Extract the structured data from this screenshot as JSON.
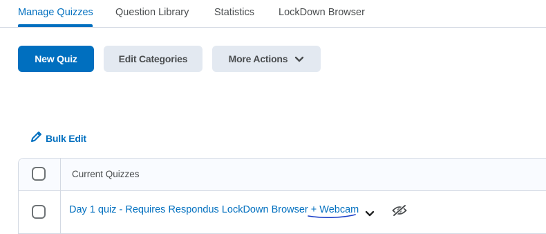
{
  "tabs": [
    {
      "label": "Manage Quizzes",
      "active": true
    },
    {
      "label": "Question Library",
      "active": false
    },
    {
      "label": "Statistics",
      "active": false
    },
    {
      "label": "LockDown Browser",
      "active": false
    }
  ],
  "toolbar": {
    "new_quiz": "New Quiz",
    "edit_categories": "Edit Categories",
    "more_actions": "More Actions"
  },
  "bulk_edit": {
    "label": "Bulk Edit",
    "icon": "pencil-icon"
  },
  "table": {
    "header": "Current Quizzes",
    "rows": [
      {
        "title": "Day 1 quiz - Requires Respondus LockDown Browser + Webcam",
        "visibility": "hidden"
      }
    ]
  },
  "colors": {
    "accent": "#006fbf",
    "secondary_button": "#e3e9f1",
    "annotation": "#1a3fc8"
  }
}
